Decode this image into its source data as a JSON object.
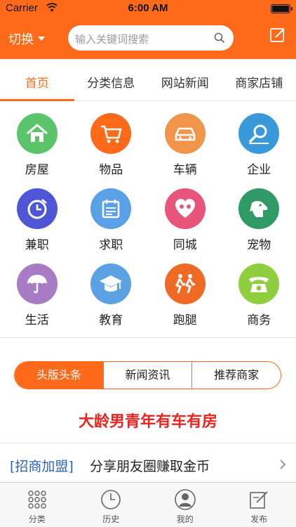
{
  "status": {
    "carrier": "Carrier",
    "time": "6:00 AM"
  },
  "nav": {
    "switch_label": "切换",
    "search_placeholder": "输入关键词搜索"
  },
  "tabs": [
    {
      "label": "首页",
      "active": true
    },
    {
      "label": "分类信息"
    },
    {
      "label": "网站新闻"
    },
    {
      "label": "商家店铺"
    }
  ],
  "categories": [
    {
      "label": "房屋",
      "icon": "house-icon",
      "color": "#5bc46a"
    },
    {
      "label": "物品",
      "icon": "cart-icon",
      "color": "#ff6a1a"
    },
    {
      "label": "车辆",
      "icon": "car-icon",
      "color": "#f0954a"
    },
    {
      "label": "企业",
      "icon": "magnifier-icon",
      "color": "#3a9ad9"
    },
    {
      "label": "兼职",
      "icon": "clock-icon",
      "color": "#4f56d6"
    },
    {
      "label": "求职",
      "icon": "calendar-icon",
      "color": "#5aa0e6"
    },
    {
      "label": "同城",
      "icon": "heart-icon",
      "color": "#e8557a"
    },
    {
      "label": "宠物",
      "icon": "dog-icon",
      "color": "#2f9a66"
    },
    {
      "label": "生活",
      "icon": "umbrella-icon",
      "color": "#a77cc4"
    },
    {
      "label": "教育",
      "icon": "graduation-cap-icon",
      "color": "#5ba1e4"
    },
    {
      "label": "跑腿",
      "icon": "runner-icon",
      "color": "#ef6b25"
    },
    {
      "label": "商务",
      "icon": "telephone-icon",
      "color": "#8fcf3f"
    }
  ],
  "segment": [
    {
      "label": "头版头条",
      "active": true
    },
    {
      "label": "新闻资讯"
    },
    {
      "label": "推荐商家"
    }
  ],
  "headline": "大龄男青年有车有房",
  "news": {
    "tag": "[招商加盟]",
    "text": "分享朋友圈赚取金币"
  },
  "tabbar": [
    {
      "label": "分类",
      "icon": "grid-dots-icon"
    },
    {
      "label": "历史",
      "icon": "clock-outline-icon"
    },
    {
      "label": "我的",
      "icon": "user-icon"
    },
    {
      "label": "发布",
      "icon": "compose-icon"
    }
  ],
  "colors": {
    "accent": "#ff6a1a",
    "headline": "#e8251f",
    "tag": "#2d63b8"
  }
}
